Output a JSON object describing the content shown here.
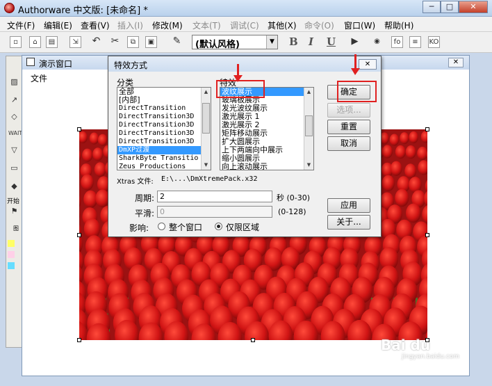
{
  "app": {
    "title": "Authorware 中文版: [未命名] *",
    "window_buttons": {
      "minimize": "─",
      "maximize": "□",
      "close": "✕"
    }
  },
  "menubar": [
    {
      "label": "文件(F)",
      "enabled": true
    },
    {
      "label": "编辑(E)",
      "enabled": true
    },
    {
      "label": "查看(V)",
      "enabled": true
    },
    {
      "label": "插入(I)",
      "enabled": false
    },
    {
      "label": "修改(M)",
      "enabled": true
    },
    {
      "label": "文本(T)",
      "enabled": false
    },
    {
      "label": "调试(C)",
      "enabled": false
    },
    {
      "label": "其他(X)",
      "enabled": true
    },
    {
      "label": "命令(O)",
      "enabled": false
    },
    {
      "label": "窗口(W)",
      "enabled": true
    },
    {
      "label": "帮助(H)",
      "enabled": true
    }
  ],
  "toolbar": {
    "style_select_value": "(默认风格)",
    "bold": "B",
    "italic": "I",
    "underline": "U",
    "icons": [
      "new-icon",
      "open-icon",
      "save-icon",
      "import-icon",
      "undo-icon",
      "cut-icon",
      "copy-icon",
      "paste-icon",
      "find-icon",
      "run-icon",
      "record-icon",
      "functions-icon",
      "variables-icon",
      "knowledge-objects-icon"
    ],
    "fo_label": "fo",
    "ko_label": "KO"
  },
  "toolbox": {
    "start_label": "开始",
    "color_label": "图",
    "swatch_colors": [
      "#ffff66",
      "#ffd0e8",
      "#66ddff"
    ]
  },
  "presentation_window": {
    "title": "演示窗口",
    "menu_file": "文件",
    "close": "✕"
  },
  "dialog": {
    "title": "特效方式",
    "close": "✕",
    "category_label": "分类",
    "categories": [
      {
        "label": "全部",
        "selected": false
      },
      {
        "label": "[内部]",
        "selected": false
      },
      {
        "label": "DirectTransition",
        "selected": false
      },
      {
        "label": "DirectTransition3D",
        "selected": false
      },
      {
        "label": "DirectTransition3D",
        "selected": false
      },
      {
        "label": "DirectTransition3D",
        "selected": false
      },
      {
        "label": "DirectTransition3D",
        "selected": false
      },
      {
        "label": "DmXP过渡",
        "selected": true
      },
      {
        "label": "SharkByte Transitio",
        "selected": false
      },
      {
        "label": "Zeus Productions",
        "selected": false
      }
    ],
    "effect_label": "特效",
    "effects": [
      {
        "label": "波纹展示",
        "selected": true
      },
      {
        "label": "玻璃板展示",
        "selected": false
      },
      {
        "label": "发光波纹展示",
        "selected": false
      },
      {
        "label": "激光展示 1",
        "selected": false
      },
      {
        "label": "激光展示 2",
        "selected": false
      },
      {
        "label": "矩阵移动展示",
        "selected": false
      },
      {
        "label": "扩大圆展示",
        "selected": false
      },
      {
        "label": "上下两端向中展示",
        "selected": false
      },
      {
        "label": "缩小圆展示",
        "selected": false
      },
      {
        "label": "向上滚动展示",
        "selected": false
      }
    ],
    "xtras_label": "Xtras 文件:",
    "xtras_path": "E:\\...\\DmXtremePack.x32",
    "period_label": "周期:",
    "period_value": "2",
    "period_unit": "秒 (0-30)",
    "smooth_label": "平滑:",
    "smooth_value": "0",
    "smooth_range": "(0-128)",
    "affect_label": "影响:",
    "affect_options": [
      {
        "label": "整个窗口",
        "checked": false
      },
      {
        "label": "仅限区域",
        "checked": true
      }
    ],
    "buttons": {
      "ok": "确定",
      "options": "选项...",
      "reset": "重置",
      "cancel": "取消",
      "apply": "应用",
      "about": "关于..."
    }
  },
  "watermark": {
    "brand": "Bai du",
    "sub": "jingyan.baidu.com"
  }
}
